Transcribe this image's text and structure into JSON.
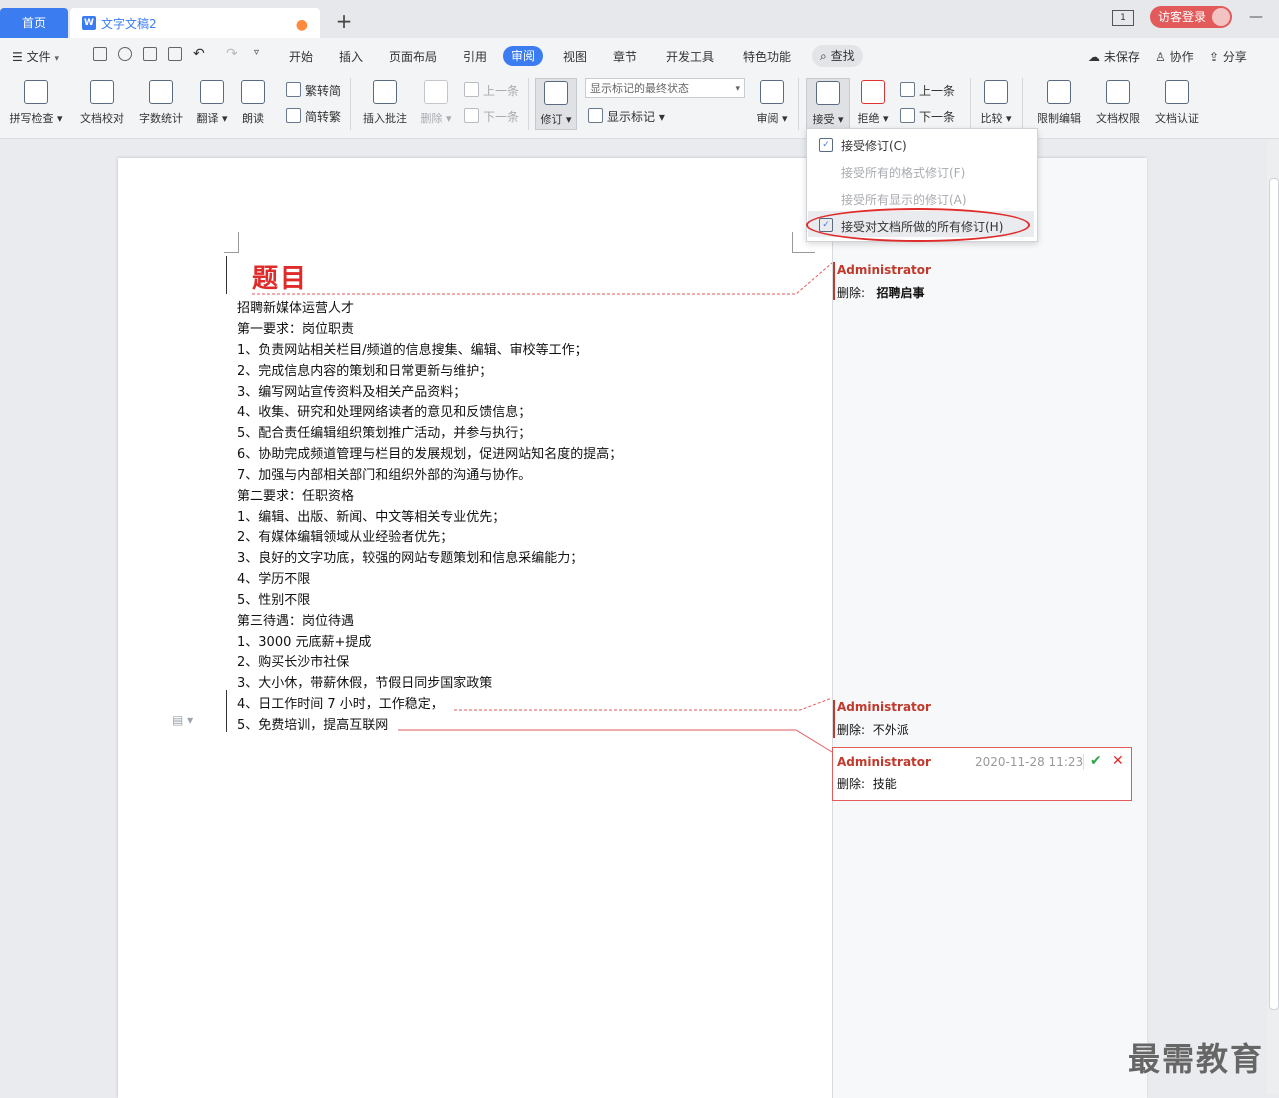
{
  "tabs": {
    "home": "首页",
    "document": "文字文稿2"
  },
  "window": {
    "login": "访客登录"
  },
  "menu": {
    "file": "文件",
    "items": [
      "开始",
      "插入",
      "页面布局",
      "引用"
    ],
    "active": "审阅",
    "items2": [
      "视图",
      "章节",
      "开发工具",
      "特色功能"
    ],
    "find": "查找",
    "unsaved": "未保存",
    "collab": "协作",
    "share": "分享"
  },
  "ribbon": {
    "spell": "拼写检查",
    "proof": "文档校对",
    "wordcount": "字数统计",
    "translate": "翻译",
    "read": "朗读",
    "trad": "繁转简",
    "simp": "简转繁",
    "insert_comment": "插入批注",
    "delete": "删除",
    "prev_comment": "上一条",
    "next_comment": "下一条",
    "track": "修订",
    "display_select": "显示标记的最终状态",
    "show_markup": "显示标记",
    "review": "审阅",
    "accept": "接受",
    "reject": "拒绝",
    "prev": "上一条",
    "next": "下一条",
    "compare": "比较",
    "restrict": "限制编辑",
    "permission": "文档权限",
    "certify": "文档认证"
  },
  "dropdown": {
    "accept_change": "接受修订(C)",
    "accept_format": "接受所有的格式修订(F)",
    "accept_shown": "接受所有显示的修订(A)",
    "accept_all": "接受对文档所做的所有修订(H)"
  },
  "document": {
    "title": "题目",
    "lines": [
      "招聘新媒体运营人才",
      "第一要求：岗位职责",
      "1、负责网站相关栏目/频道的信息搜集、编辑、审校等工作；",
      "2、完成信息内容的策划和日常更新与维护；",
      "3、编写网站宣传资料及相关产品资料；",
      "4、收集、研究和处理网络读者的意见和反馈信息；",
      "5、配合责任编辑组织策划推广活动，并参与执行；",
      "6、协助完成频道管理与栏目的发展规划，促进网站知名度的提高；",
      "7、加强与内部相关部门和组织外部的沟通与协作。",
      "第二要求：任职资格",
      "1、编辑、出版、新闻、中文等相关专业优先；",
      "2、有媒体编辑领域从业经验者优先；",
      "3、良好的文字功底，较强的网站专题策划和信息采编能力；",
      "4、学历不限",
      "5、性别不限",
      "第三待遇：岗位待遇",
      "1、3000 元底薪+提成",
      "2、购买长沙市社保",
      "3、大小休，带薪休假，节假日同步国家政策",
      "4、日工作时间 7 小时，工作稳定，",
      "5、免费培训，提高互联网"
    ]
  },
  "comments": [
    {
      "author": "Administrator",
      "label": "删除:",
      "text": "招聘启事"
    },
    {
      "author": "Administrator",
      "label": "删除:",
      "text": "不外派"
    },
    {
      "author": "Administrator",
      "date": "2020-11-28 11:23",
      "label": "删除:",
      "text": "技能"
    }
  ],
  "watermark": "最需教育"
}
